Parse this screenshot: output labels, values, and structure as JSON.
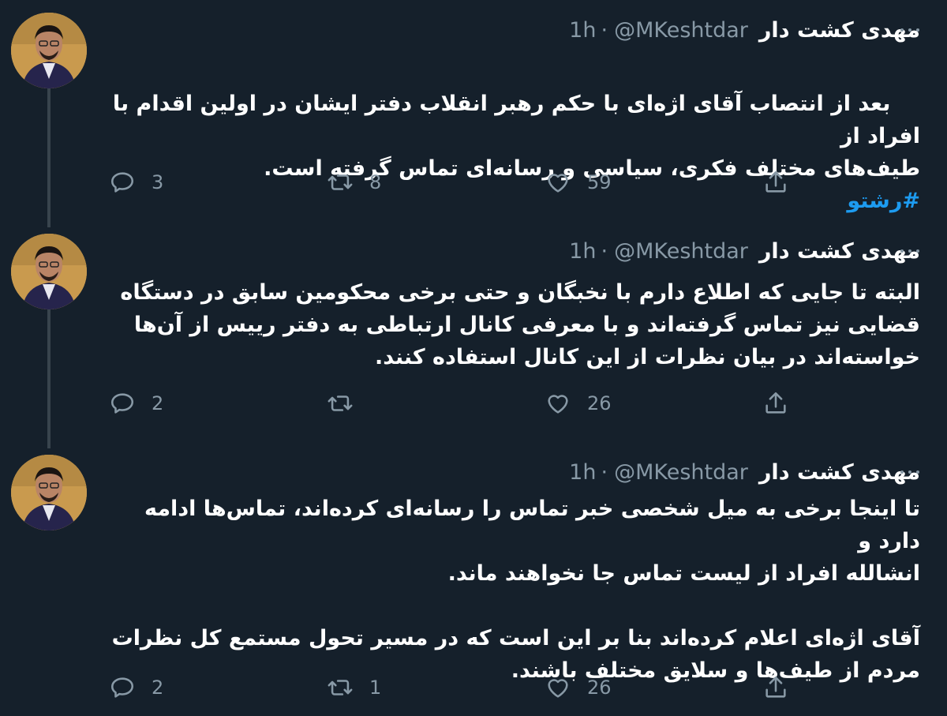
{
  "tweets": [
    {
      "name": "مهدی کشت دار",
      "handle": "@MKeshtdar",
      "time": "1h",
      "text": "بعد از انتصاب آقای اژه‌ای با حکم رهبر انقلاب دفتر ایشان در اولین اقدام با افراد از\nطیف‌های مختلف فکری، سیاسی و رسانه‌ای تماس گرفته است.",
      "hashtag": "#رشتو",
      "replies": "3",
      "retweets": "8",
      "likes": "59"
    },
    {
      "name": "مهدی کشت دار",
      "handle": "@MKeshtdar",
      "time": "1h",
      "text": "البته تا جایی که اطلاع دارم با نخبگان و حتی برخی محکومین سابق در دستگاه\nقضایی نیز تماس گرفته‌اند و با معرفی کانال ارتباطی به دفتر رییس از آن‌ها\nخواسته‌اند در بیان نظرات از این کانال استفاده کنند.",
      "replies": "2",
      "retweets": "",
      "likes": "26"
    },
    {
      "name": "مهدی کشت دار",
      "handle": "@MKeshtdar",
      "time": "1h",
      "text": "تا اینجا برخی به میل شخصی خبر تماس را رسانه‌ای کرده‌اند، تماس‌ها ادامه دارد و\nانشالله افراد از لیست تماس جا نخواهند ماند.\n\nآقای اژه‌ای اعلام کرده‌اند بنا بر این است که در مسیر تحول مستمع کل نظرات\nمردم از طیف‌ها و سلایق مختلف باشند.",
      "replies": "2",
      "retweets": "1",
      "likes": "26"
    }
  ],
  "icons": {
    "reply": "reply-icon",
    "retweet": "retweet-icon",
    "like": "heart-icon",
    "share": "share-icon",
    "more": "more-icon"
  },
  "colors": {
    "background": "#15202b",
    "muted": "#8899a6",
    "link": "#1d9bf0",
    "thread_line": "#38444d"
  }
}
